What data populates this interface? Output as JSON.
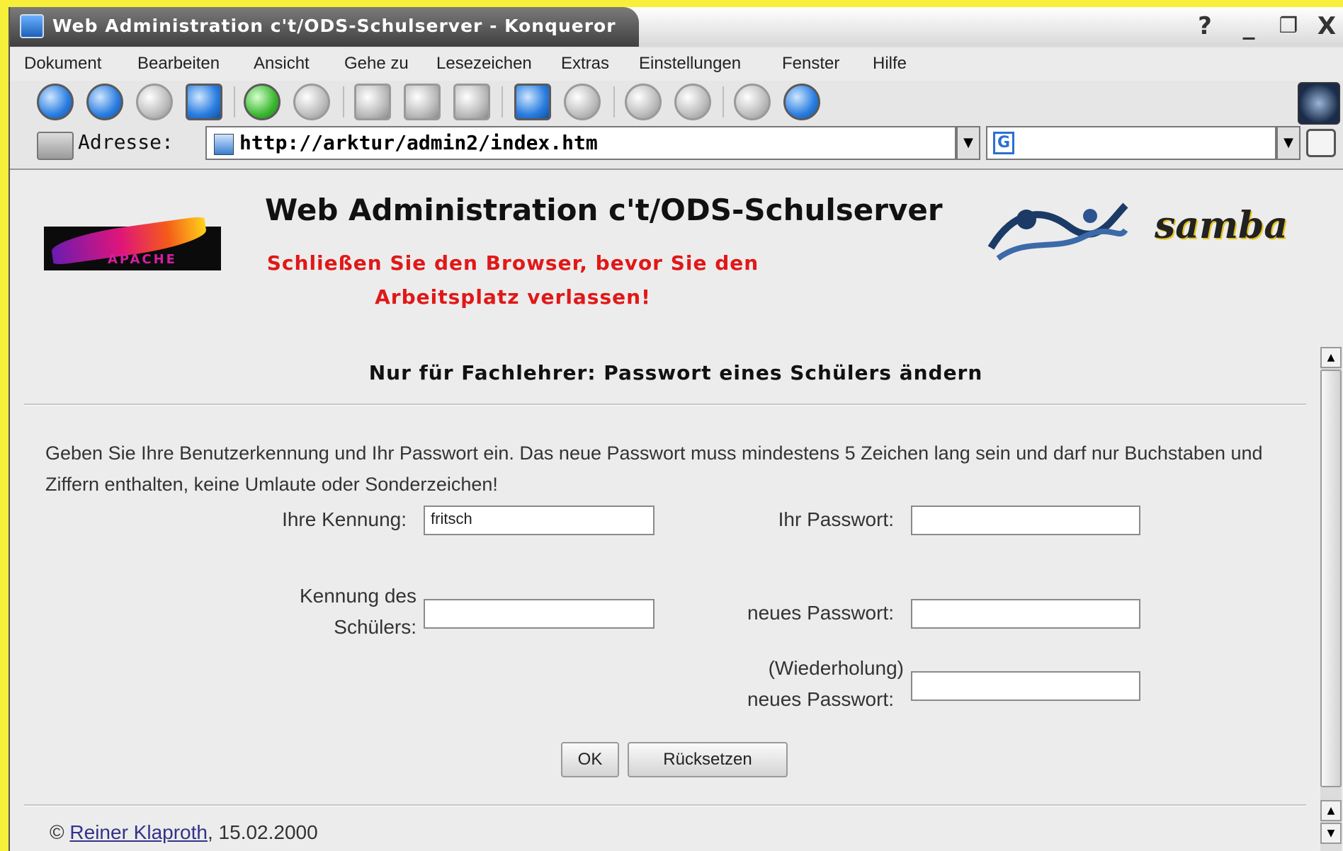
{
  "window": {
    "title": "Web Administration c't/ODS-Schulserver - Konqueror",
    "controls": {
      "help": "?",
      "minimize": "_",
      "maximize": "❐",
      "close": "X"
    }
  },
  "menu": {
    "items": [
      "Dokument",
      "Bearbeiten",
      "Ansicht",
      "Gehe zu",
      "Lesezeichen",
      "Extras",
      "Einstellungen",
      "Fenster",
      "Hilfe"
    ]
  },
  "toolbar": {
    "icons": [
      "back-icon",
      "forward-icon",
      "up-icon",
      "home-icon",
      "reload-icon",
      "stop-icon",
      "cut-icon",
      "copy-icon",
      "paste-icon",
      "print-icon",
      "find-icon",
      "zoom-in-icon",
      "zoom-out-icon",
      "security-icon",
      "globe-icon"
    ]
  },
  "addressbar": {
    "label": "Adresse:",
    "url": "http://arktur/admin2/index.htm",
    "search_engine": "G"
  },
  "page": {
    "title": "Web Administration c't/ODS-Schulserver",
    "warning_line1": "Schließen Sie den Browser, bevor Sie den",
    "warning_line2": "Arbeitsplatz verlassen!",
    "apache_logo_text": "APACHE",
    "samba_logo_text": "samba",
    "heading": "Nur für Fachlehrer: Passwort eines Schülers ändern",
    "instructions": "Geben Sie Ihre Benutzerkennung und Ihr Passwort ein. Das neue Passwort muss mindestens 5 Zeichen lang sein und darf nur Buchstaben und Ziffern enthalten, keine Umlaute oder Sonderzeichen!",
    "form": {
      "kennung_label": "Ihre Kennung:",
      "kennung_value": "fritsch",
      "passwort_label": "Ihr Passwort:",
      "schueler_label_line1": "Kennung des",
      "schueler_label_line2": "Schülers:",
      "neues_passwort_label": "neues Passwort:",
      "wiederholung_line1": "(Wiederholung)",
      "wiederholung_line2": "neues Passwort:",
      "ok_label": "OK",
      "reset_label": "Rücksetzen"
    },
    "footer": {
      "copyright": "©",
      "author": "Reiner Klaproth",
      "date": ", 15.02.2000"
    }
  }
}
